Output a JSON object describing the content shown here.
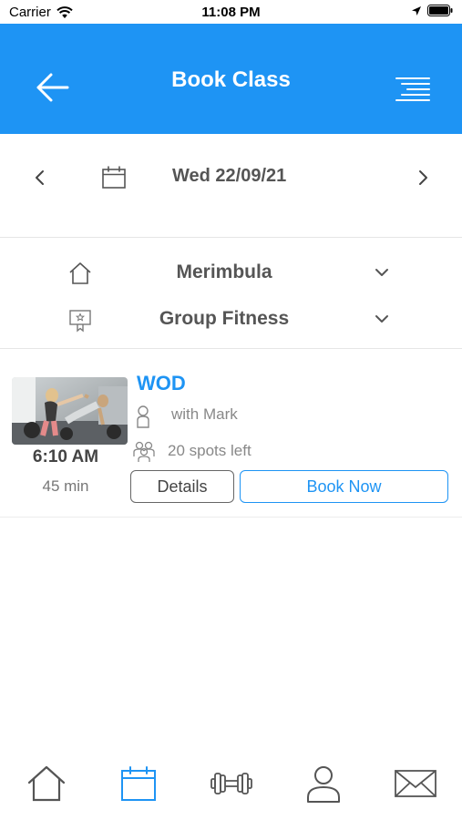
{
  "status_bar": {
    "carrier": "Carrier",
    "time": "11:08 PM"
  },
  "header": {
    "title": "Book Class",
    "back_icon": "arrow-left-icon",
    "menu_icon": "menu-lines-icon"
  },
  "date_nav": {
    "date": "Wed 22/09/21",
    "prev_icon": "chevron-left-icon",
    "next_icon": "chevron-right-icon",
    "calendar_icon": "calendar-icon"
  },
  "filters": {
    "location": "Merimbula",
    "category": "Group Fitness"
  },
  "classes": [
    {
      "name": "WOD",
      "instructor": "with Mark",
      "spots": "20 spots left",
      "time": "6:10 AM",
      "duration": "45 min",
      "details_label": "Details",
      "book_label": "Book Now"
    }
  ],
  "tabs": [
    {
      "icon": "home-icon",
      "active": false
    },
    {
      "icon": "calendar-icon",
      "active": true
    },
    {
      "icon": "dumbbell-icon",
      "active": false
    },
    {
      "icon": "profile-icon",
      "active": false
    },
    {
      "icon": "mail-icon",
      "active": false
    }
  ],
  "colors": {
    "accent": "#1e94f4",
    "text": "#555555",
    "inactive_tab": "#555555"
  }
}
